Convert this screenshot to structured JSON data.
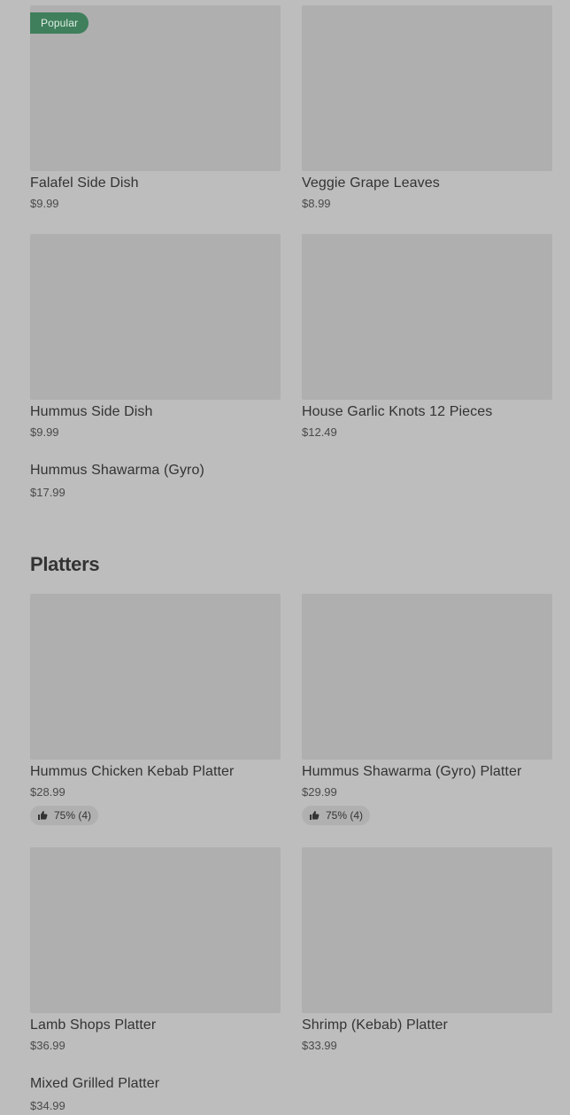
{
  "badge": {
    "label": "Popular"
  },
  "section": {
    "title": "Platters"
  },
  "items": [
    {
      "name": "Falafel Side Dish",
      "price": "$9.99"
    },
    {
      "name": "Veggie Grape Leaves",
      "price": "$8.99"
    },
    {
      "name": "Hummus Side Dish",
      "price": "$9.99"
    },
    {
      "name": "House Garlic Knots 12 Pieces",
      "price": "$12.49"
    },
    {
      "name": "Hummus Shawarma (Gyro)",
      "price": "$17.99"
    }
  ],
  "platters": [
    {
      "name": "Hummus Chicken Kebab Platter",
      "price": "$28.99",
      "rating": "75% (4)"
    },
    {
      "name": "Hummus  Shawarma (Gyro) Platter",
      "price": "$29.99",
      "rating": "75% (4)"
    },
    {
      "name": "Lamb Shops Platter",
      "price": "$36.99"
    },
    {
      "name": "Shrimp (Kebab) Platter",
      "price": "$33.99"
    },
    {
      "name": "Mixed Grilled Platter",
      "price": "$34.99"
    }
  ],
  "icons": {
    "rating": "thumbs-up-icon"
  }
}
